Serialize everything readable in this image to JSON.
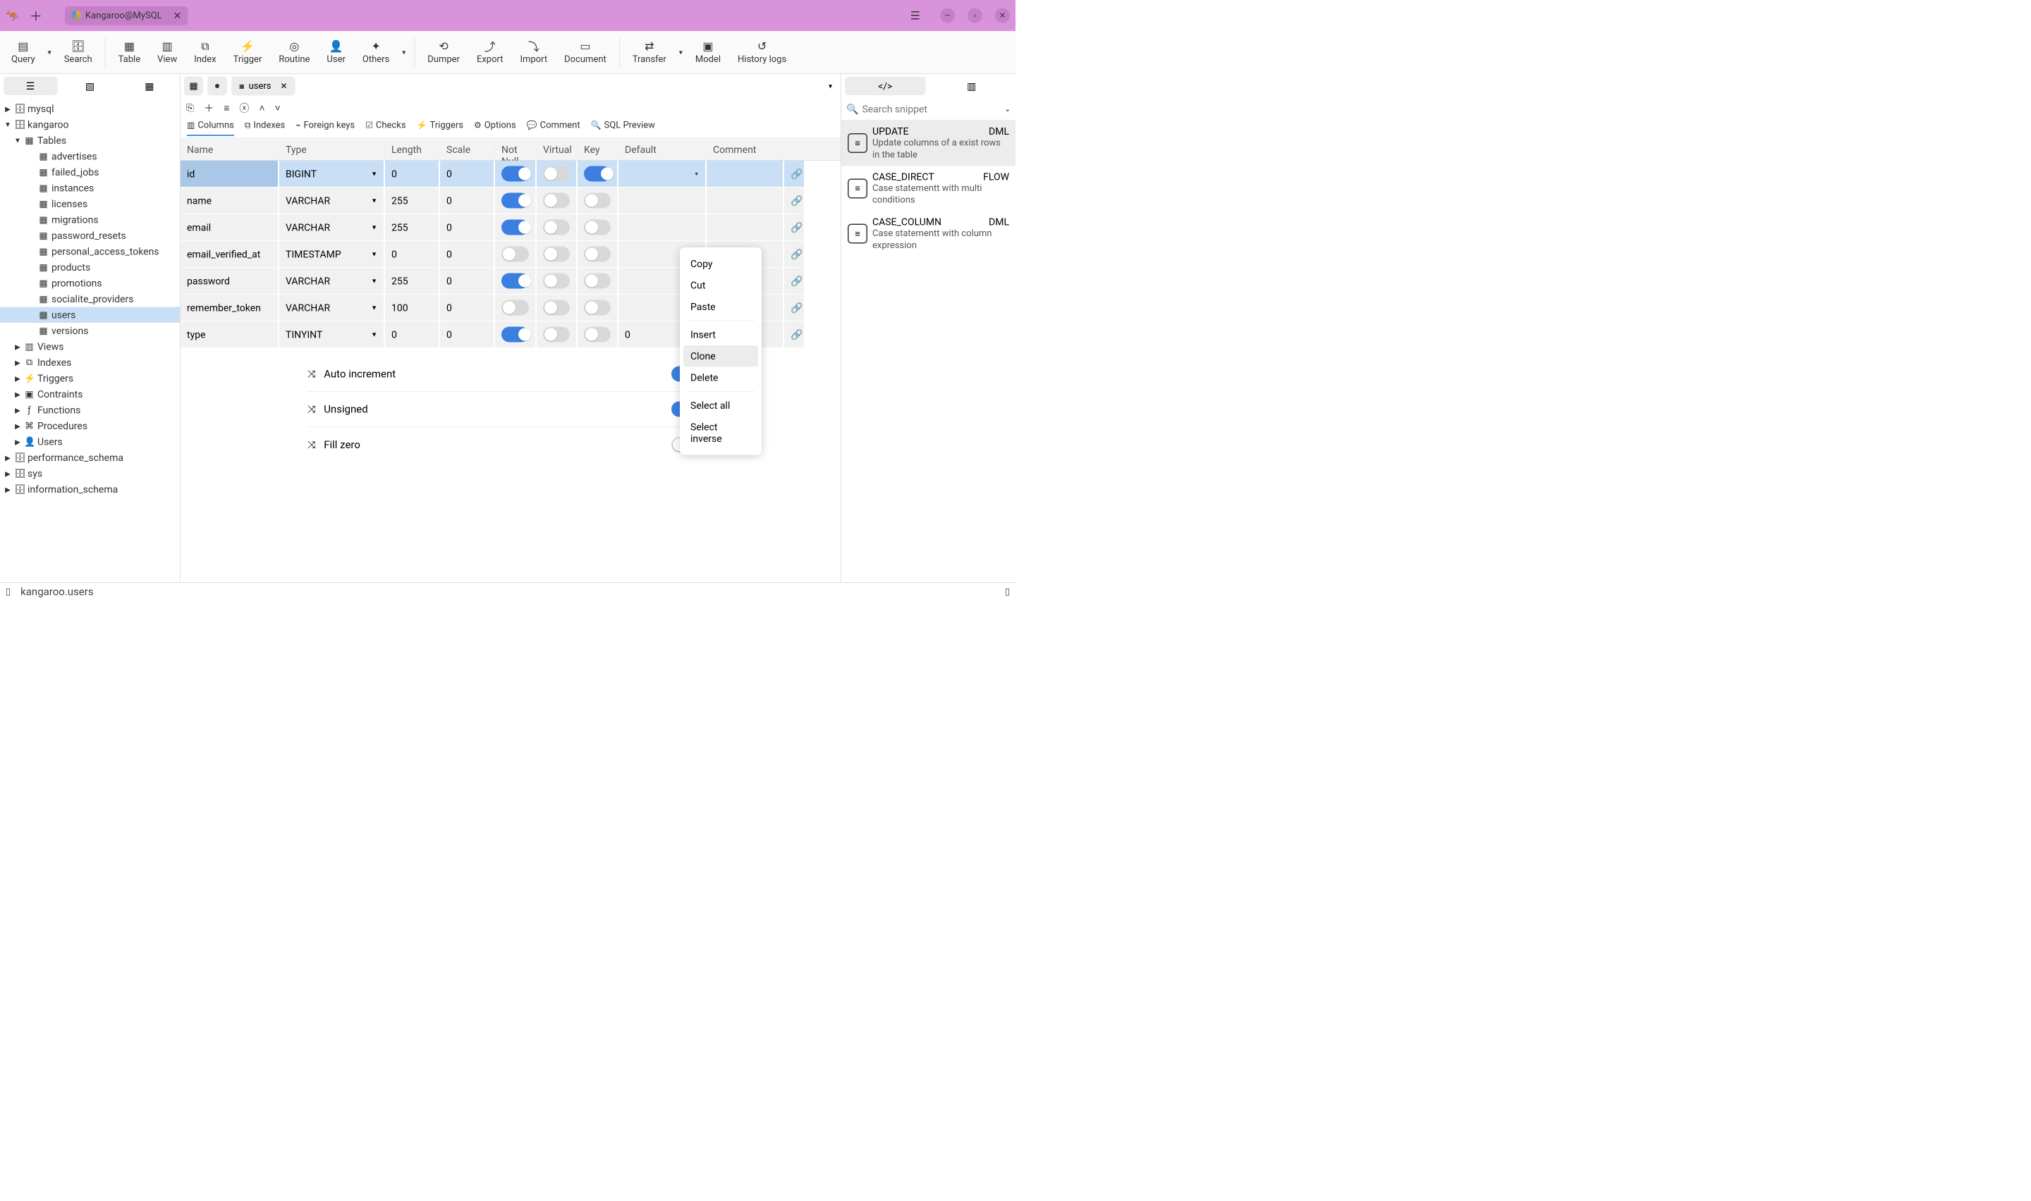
{
  "titlebar": {
    "tab_label": "Kangaroo@MySQL"
  },
  "toolbar": {
    "query": "Query",
    "search": "Search",
    "table": "Table",
    "view": "View",
    "index": "Index",
    "trigger": "Trigger",
    "routine": "Routine",
    "user": "User",
    "others": "Others",
    "dumper": "Dumper",
    "export": "Export",
    "import": "Import",
    "document": "Document",
    "transfer": "Transfer",
    "model": "Model",
    "history": "History logs"
  },
  "tree": {
    "db_mysql": "mysql",
    "db_kangaroo": "kangaroo",
    "folder_tables": "Tables",
    "tables": [
      "advertises",
      "failed_jobs",
      "instances",
      "licenses",
      "migrations",
      "password_resets",
      "personal_access_tokens",
      "products",
      "promotions",
      "socialite_providers",
      "users",
      "versions"
    ],
    "folders": [
      "Views",
      "Indexes",
      "Triggers",
      "Contraints",
      "Functions",
      "Procedures",
      "Users"
    ],
    "db_perf": "performance_schema",
    "db_sys": "sys",
    "db_info": "information_schema"
  },
  "center_tabs": {
    "users": "users"
  },
  "subtabs": {
    "columns": "Columns",
    "indexes": "Indexes",
    "fks": "Foreign keys",
    "checks": "Checks",
    "triggers": "Triggers",
    "options": "Options",
    "comment": "Comment",
    "sql_preview": "SQL Preview"
  },
  "headers": {
    "name": "Name",
    "type": "Type",
    "length": "Length",
    "scale": "Scale",
    "notnull": "Not Null",
    "virtual": "Virtual",
    "key": "Key",
    "default": "Default",
    "comment": "Comment"
  },
  "rows": [
    {
      "name": "id",
      "type": "BIGINT",
      "length": "0",
      "scale": "0",
      "nn": true,
      "virt": false,
      "key": true,
      "def": "",
      "selected": true
    },
    {
      "name": "name",
      "type": "VARCHAR",
      "length": "255",
      "scale": "0",
      "nn": true,
      "virt": false,
      "key": false,
      "def": ""
    },
    {
      "name": "email",
      "type": "VARCHAR",
      "length": "255",
      "scale": "0",
      "nn": true,
      "virt": false,
      "key": false,
      "def": ""
    },
    {
      "name": "email_verified_at",
      "type": "TIMESTAMP",
      "length": "0",
      "scale": "0",
      "nn": false,
      "virt": false,
      "key": false,
      "def": ""
    },
    {
      "name": "password",
      "type": "VARCHAR",
      "length": "255",
      "scale": "0",
      "nn": true,
      "virt": false,
      "key": false,
      "def": ""
    },
    {
      "name": "remember_token",
      "type": "VARCHAR",
      "length": "100",
      "scale": "0",
      "nn": false,
      "virt": false,
      "key": false,
      "def": ""
    },
    {
      "name": "type",
      "type": "TINYINT",
      "length": "0",
      "scale": "0",
      "nn": true,
      "virt": false,
      "key": false,
      "def": "0"
    }
  ],
  "extras": {
    "auto_inc": "Auto increment",
    "unsigned": "Unsigned",
    "fill_zero": "Fill zero",
    "auto_inc_on": true,
    "unsigned_on": true,
    "fill_zero_on": false
  },
  "ctx": {
    "copy": "Copy",
    "cut": "Cut",
    "paste": "Paste",
    "insert": "Insert",
    "clone": "Clone",
    "delete": "Delete",
    "select_all": "Select all",
    "select_inverse": "Select inverse"
  },
  "search": {
    "placeholder": "Search snippet"
  },
  "snippets": [
    {
      "title": "UPDATE",
      "tag": "DML",
      "desc": "Update columns of a exist rows in the table",
      "active": true
    },
    {
      "title": "CASE_DIRECT",
      "tag": "FLOW",
      "desc": "Case statementt with multi conditions"
    },
    {
      "title": "CASE_COLUMN",
      "tag": "DML",
      "desc": "Case statementt with column expression"
    }
  ],
  "status": {
    "path": "kangaroo.users"
  }
}
